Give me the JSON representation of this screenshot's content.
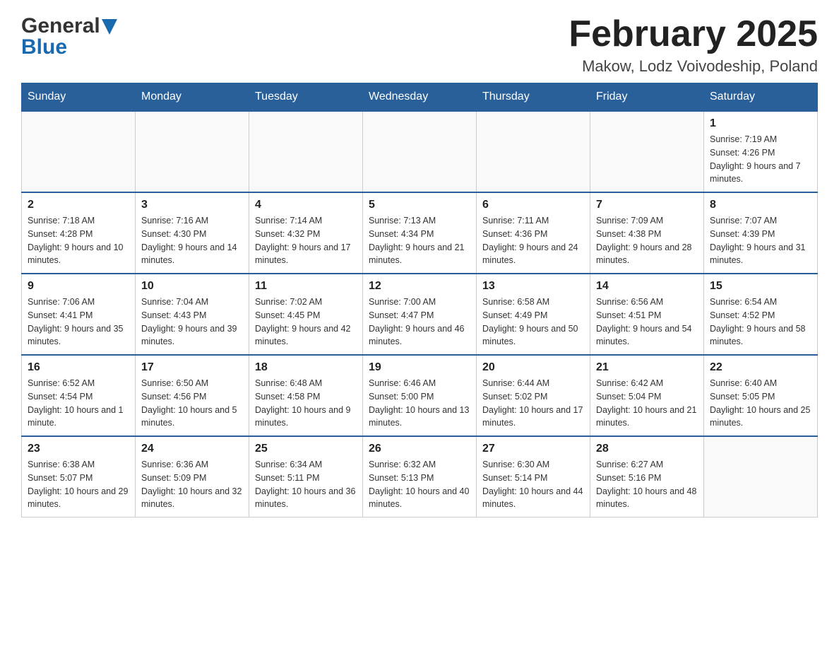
{
  "header": {
    "logo_general": "General",
    "logo_blue": "Blue",
    "title": "February 2025",
    "subtitle": "Makow, Lodz Voivodeship, Poland"
  },
  "days_of_week": [
    "Sunday",
    "Monday",
    "Tuesday",
    "Wednesday",
    "Thursday",
    "Friday",
    "Saturday"
  ],
  "weeks": [
    [
      {
        "day": "",
        "info": ""
      },
      {
        "day": "",
        "info": ""
      },
      {
        "day": "",
        "info": ""
      },
      {
        "day": "",
        "info": ""
      },
      {
        "day": "",
        "info": ""
      },
      {
        "day": "",
        "info": ""
      },
      {
        "day": "1",
        "info": "Sunrise: 7:19 AM\nSunset: 4:26 PM\nDaylight: 9 hours and 7 minutes."
      }
    ],
    [
      {
        "day": "2",
        "info": "Sunrise: 7:18 AM\nSunset: 4:28 PM\nDaylight: 9 hours and 10 minutes."
      },
      {
        "day": "3",
        "info": "Sunrise: 7:16 AM\nSunset: 4:30 PM\nDaylight: 9 hours and 14 minutes."
      },
      {
        "day": "4",
        "info": "Sunrise: 7:14 AM\nSunset: 4:32 PM\nDaylight: 9 hours and 17 minutes."
      },
      {
        "day": "5",
        "info": "Sunrise: 7:13 AM\nSunset: 4:34 PM\nDaylight: 9 hours and 21 minutes."
      },
      {
        "day": "6",
        "info": "Sunrise: 7:11 AM\nSunset: 4:36 PM\nDaylight: 9 hours and 24 minutes."
      },
      {
        "day": "7",
        "info": "Sunrise: 7:09 AM\nSunset: 4:38 PM\nDaylight: 9 hours and 28 minutes."
      },
      {
        "day": "8",
        "info": "Sunrise: 7:07 AM\nSunset: 4:39 PM\nDaylight: 9 hours and 31 minutes."
      }
    ],
    [
      {
        "day": "9",
        "info": "Sunrise: 7:06 AM\nSunset: 4:41 PM\nDaylight: 9 hours and 35 minutes."
      },
      {
        "day": "10",
        "info": "Sunrise: 7:04 AM\nSunset: 4:43 PM\nDaylight: 9 hours and 39 minutes."
      },
      {
        "day": "11",
        "info": "Sunrise: 7:02 AM\nSunset: 4:45 PM\nDaylight: 9 hours and 42 minutes."
      },
      {
        "day": "12",
        "info": "Sunrise: 7:00 AM\nSunset: 4:47 PM\nDaylight: 9 hours and 46 minutes."
      },
      {
        "day": "13",
        "info": "Sunrise: 6:58 AM\nSunset: 4:49 PM\nDaylight: 9 hours and 50 minutes."
      },
      {
        "day": "14",
        "info": "Sunrise: 6:56 AM\nSunset: 4:51 PM\nDaylight: 9 hours and 54 minutes."
      },
      {
        "day": "15",
        "info": "Sunrise: 6:54 AM\nSunset: 4:52 PM\nDaylight: 9 hours and 58 minutes."
      }
    ],
    [
      {
        "day": "16",
        "info": "Sunrise: 6:52 AM\nSunset: 4:54 PM\nDaylight: 10 hours and 1 minute."
      },
      {
        "day": "17",
        "info": "Sunrise: 6:50 AM\nSunset: 4:56 PM\nDaylight: 10 hours and 5 minutes."
      },
      {
        "day": "18",
        "info": "Sunrise: 6:48 AM\nSunset: 4:58 PM\nDaylight: 10 hours and 9 minutes."
      },
      {
        "day": "19",
        "info": "Sunrise: 6:46 AM\nSunset: 5:00 PM\nDaylight: 10 hours and 13 minutes."
      },
      {
        "day": "20",
        "info": "Sunrise: 6:44 AM\nSunset: 5:02 PM\nDaylight: 10 hours and 17 minutes."
      },
      {
        "day": "21",
        "info": "Sunrise: 6:42 AM\nSunset: 5:04 PM\nDaylight: 10 hours and 21 minutes."
      },
      {
        "day": "22",
        "info": "Sunrise: 6:40 AM\nSunset: 5:05 PM\nDaylight: 10 hours and 25 minutes."
      }
    ],
    [
      {
        "day": "23",
        "info": "Sunrise: 6:38 AM\nSunset: 5:07 PM\nDaylight: 10 hours and 29 minutes."
      },
      {
        "day": "24",
        "info": "Sunrise: 6:36 AM\nSunset: 5:09 PM\nDaylight: 10 hours and 32 minutes."
      },
      {
        "day": "25",
        "info": "Sunrise: 6:34 AM\nSunset: 5:11 PM\nDaylight: 10 hours and 36 minutes."
      },
      {
        "day": "26",
        "info": "Sunrise: 6:32 AM\nSunset: 5:13 PM\nDaylight: 10 hours and 40 minutes."
      },
      {
        "day": "27",
        "info": "Sunrise: 6:30 AM\nSunset: 5:14 PM\nDaylight: 10 hours and 44 minutes."
      },
      {
        "day": "28",
        "info": "Sunrise: 6:27 AM\nSunset: 5:16 PM\nDaylight: 10 hours and 48 minutes."
      },
      {
        "day": "",
        "info": ""
      }
    ]
  ]
}
